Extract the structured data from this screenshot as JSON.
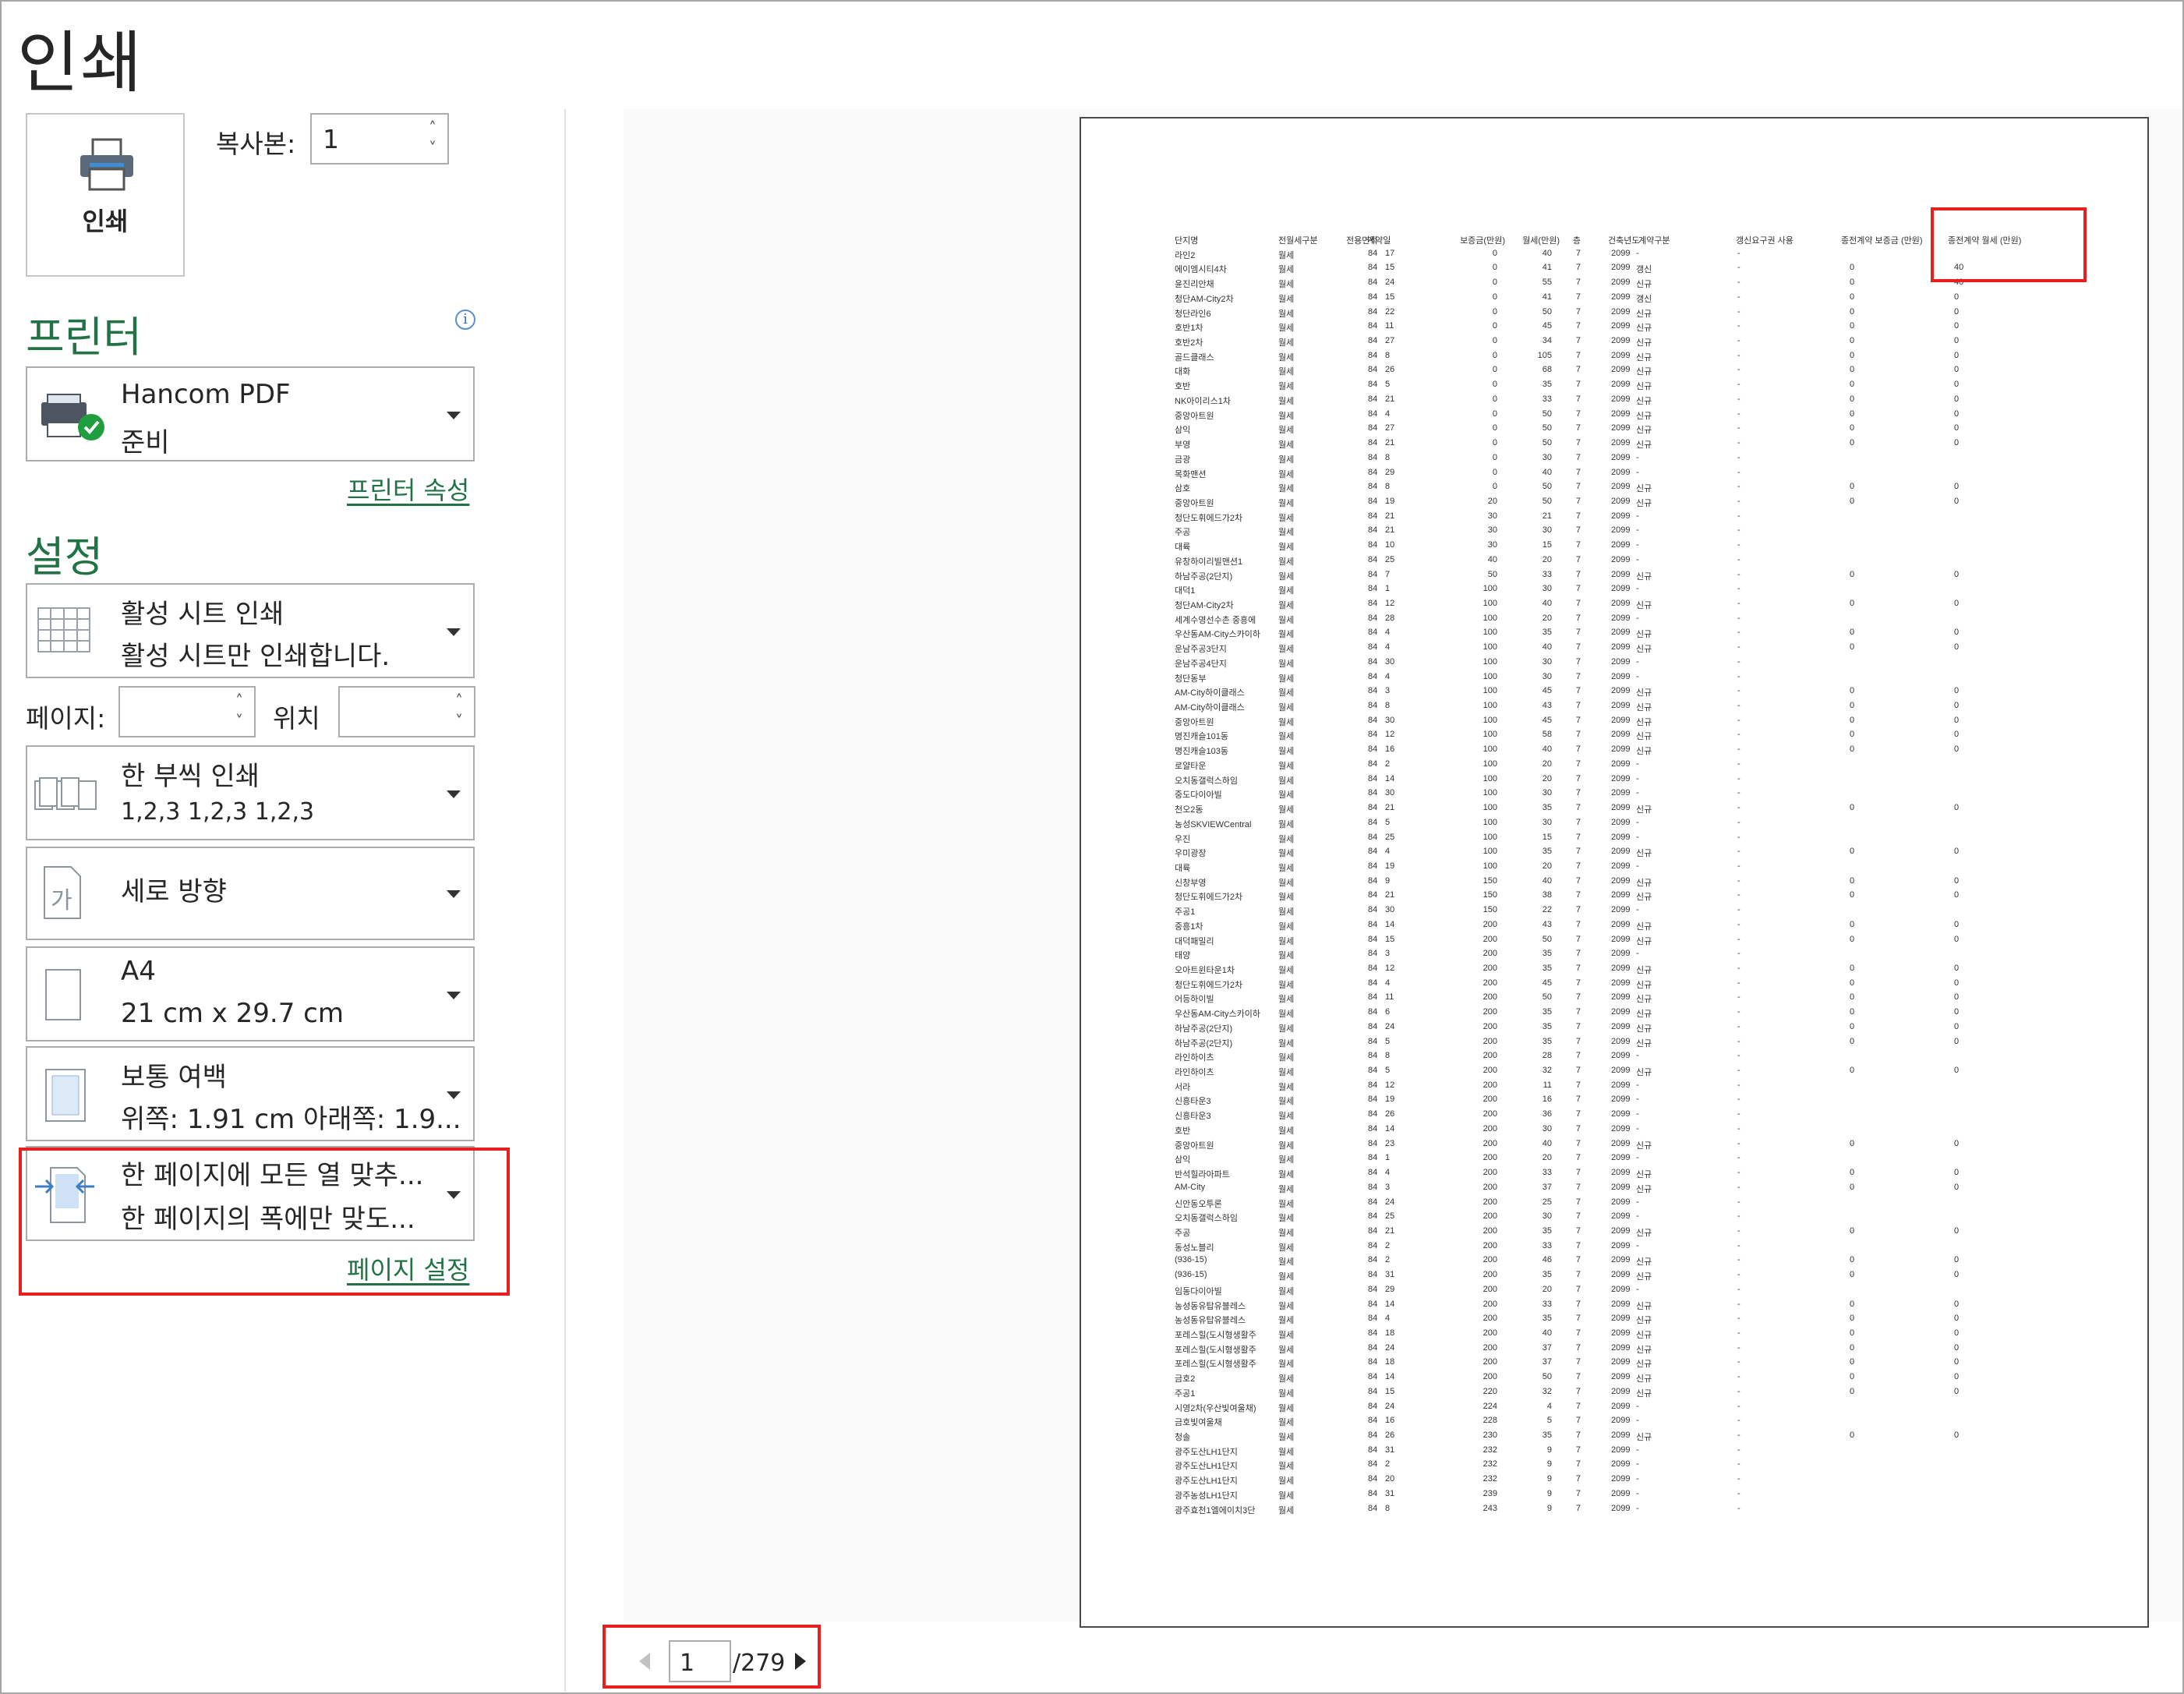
{
  "header": {
    "title": "인쇄"
  },
  "print_button": {
    "label": "인쇄"
  },
  "copies": {
    "label": "복사본:",
    "value": "1"
  },
  "printer_section": {
    "title": "프린터",
    "info": "i",
    "printer_name": "Hancom PDF",
    "printer_status": "준비",
    "properties_link": "프린터 속성"
  },
  "settings_section": {
    "title": "설정",
    "what": {
      "line1": "활성 시트 인쇄",
      "line2": "활성 시트만 인쇄합니다."
    },
    "pages_label": "페이지:",
    "to_label": "위치",
    "collate": {
      "line1": "한 부씩 인쇄",
      "line2": "1,2,3      1,2,3      1,2,3"
    },
    "orientation": {
      "line1": "세로 방향",
      "icon_text": "가"
    },
    "paper": {
      "line1": "A4",
      "line2": "21 cm x 29.7 cm"
    },
    "margins": {
      "line1": "보통 여백",
      "line2": "위쪽: 1.91 cm 아래쪽: 1.9..."
    },
    "scaling": {
      "line1": "한 페이지에 모든 열 맞추...",
      "line2": "한 페이지의 폭에만 맞도..."
    },
    "page_setup_link": "페이지 설정"
  },
  "pager": {
    "current": "1",
    "total": "/279"
  },
  "preview_table": {
    "headers": [
      "단지명",
      "전월세구분",
      "전용면적",
      "계약일",
      "보증금(만원)",
      "월세(만원)",
      "층",
      "건축년도",
      "계약구분",
      "갱신요구권 사용",
      "종전계약 보증금 (만원)",
      "종전계약 월세 (만원)"
    ],
    "rows": [
      [
        "라인2",
        "월세",
        "84",
        "17",
        "0",
        "40",
        "7",
        "2099",
        "-",
        "-",
        "",
        ""
      ],
      [
        "에이엠시티4차",
        "월세",
        "84",
        "15",
        "0",
        "41",
        "7",
        "2099",
        "갱신",
        "-",
        "0",
        "40"
      ],
      [
        "윤진리안채",
        "월세",
        "84",
        "24",
        "0",
        "55",
        "7",
        "2099",
        "신규",
        "-",
        "0",
        "40"
      ],
      [
        "청단AM-City2차",
        "월세",
        "84",
        "15",
        "0",
        "41",
        "7",
        "2099",
        "갱신",
        "-",
        "0",
        "0"
      ],
      [
        "청단라인6",
        "월세",
        "84",
        "22",
        "0",
        "50",
        "7",
        "2099",
        "신규",
        "-",
        "0",
        "0"
      ],
      [
        "호반1차",
        "월세",
        "84",
        "11",
        "0",
        "45",
        "7",
        "2099",
        "신규",
        "-",
        "0",
        "0"
      ],
      [
        "호반2차",
        "월세",
        "84",
        "27",
        "0",
        "34",
        "7",
        "2099",
        "신규",
        "-",
        "0",
        "0"
      ],
      [
        "골드클래스",
        "월세",
        "84",
        "8",
        "0",
        "105",
        "7",
        "2099",
        "신규",
        "-",
        "0",
        "0"
      ],
      [
        "대화",
        "월세",
        "84",
        "26",
        "0",
        "68",
        "7",
        "2099",
        "신규",
        "-",
        "0",
        "0"
      ],
      [
        "호반",
        "월세",
        "84",
        "5",
        "0",
        "35",
        "7",
        "2099",
        "신규",
        "-",
        "0",
        "0"
      ],
      [
        "NK아이리스1차",
        "월세",
        "84",
        "21",
        "0",
        "33",
        "7",
        "2099",
        "신규",
        "-",
        "0",
        "0"
      ],
      [
        "중앙아트원",
        "월세",
        "84",
        "4",
        "0",
        "50",
        "7",
        "2099",
        "신규",
        "-",
        "0",
        "0"
      ],
      [
        "삼익",
        "월세",
        "84",
        "27",
        "0",
        "50",
        "7",
        "2099",
        "신규",
        "-",
        "0",
        "0"
      ],
      [
        "부영",
        "월세",
        "84",
        "21",
        "0",
        "50",
        "7",
        "2099",
        "신규",
        "-",
        "0",
        "0"
      ],
      [
        "금광",
        "월세",
        "84",
        "8",
        "0",
        "30",
        "7",
        "2099",
        "-",
        "-",
        "",
        ""
      ],
      [
        "목화맨션",
        "월세",
        "84",
        "29",
        "0",
        "40",
        "7",
        "2099",
        "-",
        "-",
        "",
        ""
      ],
      [
        "삼호",
        "월세",
        "84",
        "8",
        "0",
        "50",
        "7",
        "2099",
        "신규",
        "-",
        "0",
        "0"
      ],
      [
        "중앙아트원",
        "월세",
        "84",
        "19",
        "20",
        "50",
        "7",
        "2099",
        "신규",
        "-",
        "0",
        "0"
      ],
      [
        "청단도휘에드가2차",
        "월세",
        "84",
        "21",
        "30",
        "21",
        "7",
        "2099",
        "-",
        "-",
        "",
        ""
      ],
      [
        "주공",
        "월세",
        "84",
        "21",
        "30",
        "30",
        "7",
        "2099",
        "-",
        "-",
        "",
        ""
      ],
      [
        "대륙",
        "월세",
        "84",
        "10",
        "30",
        "15",
        "7",
        "2099",
        "-",
        "-",
        "",
        ""
      ],
      [
        "유창하이리빌맨션1",
        "월세",
        "84",
        "25",
        "40",
        "20",
        "7",
        "2099",
        "-",
        "-",
        "",
        ""
      ],
      [
        "하남주공(2단지)",
        "월세",
        "84",
        "7",
        "50",
        "33",
        "7",
        "2099",
        "신규",
        "-",
        "0",
        "0"
      ],
      [
        "대덕1",
        "월세",
        "84",
        "1",
        "100",
        "30",
        "7",
        "2099",
        "-",
        "-",
        "",
        ""
      ],
      [
        "청단AM-City2차",
        "월세",
        "84",
        "12",
        "100",
        "40",
        "7",
        "2099",
        "신규",
        "-",
        "0",
        "0"
      ],
      [
        "세계수영선수촌 중흥에",
        "월세",
        "84",
        "28",
        "100",
        "20",
        "7",
        "2099",
        "-",
        "-",
        "",
        ""
      ],
      [
        "우산동AM-City스카이하",
        "월세",
        "84",
        "4",
        "100",
        "35",
        "7",
        "2099",
        "신규",
        "-",
        "0",
        "0"
      ],
      [
        "운남주공3단지",
        "월세",
        "84",
        "4",
        "100",
        "40",
        "7",
        "2099",
        "신규",
        "-",
        "0",
        "0"
      ],
      [
        "운남주공4단지",
        "월세",
        "84",
        "30",
        "100",
        "30",
        "7",
        "2099",
        "-",
        "-",
        "",
        ""
      ],
      [
        "청단동부",
        "월세",
        "84",
        "4",
        "100",
        "30",
        "7",
        "2099",
        "-",
        "-",
        "",
        ""
      ],
      [
        "AM-City하이클래스",
        "월세",
        "84",
        "3",
        "100",
        "45",
        "7",
        "2099",
        "신규",
        "-",
        "0",
        "0"
      ],
      [
        "AM-City하이클래스",
        "월세",
        "84",
        "8",
        "100",
        "43",
        "7",
        "2099",
        "신규",
        "-",
        "0",
        "0"
      ],
      [
        "중앙아트원",
        "월세",
        "84",
        "30",
        "100",
        "45",
        "7",
        "2099",
        "신규",
        "-",
        "0",
        "0"
      ],
      [
        "명진캐슬101동",
        "월세",
        "84",
        "12",
        "100",
        "58",
        "7",
        "2099",
        "신규",
        "-",
        "0",
        "0"
      ],
      [
        "명진캐슬103동",
        "월세",
        "84",
        "16",
        "100",
        "40",
        "7",
        "2099",
        "신규",
        "-",
        "0",
        "0"
      ],
      [
        "로얄타운",
        "월세",
        "84",
        "2",
        "100",
        "20",
        "7",
        "2099",
        "-",
        "-",
        "",
        ""
      ],
      [
        "오치동갤럭스하임",
        "월세",
        "84",
        "14",
        "100",
        "20",
        "7",
        "2099",
        "-",
        "-",
        "",
        ""
      ],
      [
        "중도다이아빌",
        "월세",
        "84",
        "30",
        "100",
        "30",
        "7",
        "2099",
        "-",
        "-",
        "",
        ""
      ],
      [
        "천오2동",
        "월세",
        "84",
        "21",
        "100",
        "35",
        "7",
        "2099",
        "신규",
        "-",
        "0",
        "0"
      ],
      [
        "농성SKVIEWCentral",
        "월세",
        "84",
        "5",
        "100",
        "30",
        "7",
        "2099",
        "-",
        "-",
        "",
        ""
      ],
      [
        "우진",
        "월세",
        "84",
        "25",
        "100",
        "15",
        "7",
        "2099",
        "-",
        "-",
        "",
        ""
      ],
      [
        "우미광장",
        "월세",
        "84",
        "4",
        "100",
        "35",
        "7",
        "2099",
        "신규",
        "-",
        "0",
        "0"
      ],
      [
        "대륙",
        "월세",
        "84",
        "19",
        "100",
        "20",
        "7",
        "2099",
        "-",
        "-",
        "",
        ""
      ],
      [
        "신창부영",
        "월세",
        "84",
        "9",
        "150",
        "40",
        "7",
        "2099",
        "신규",
        "-",
        "0",
        "0"
      ],
      [
        "청단도휘에드가2차",
        "월세",
        "84",
        "21",
        "150",
        "38",
        "7",
        "2099",
        "신규",
        "-",
        "0",
        "0"
      ],
      [
        "주공1",
        "월세",
        "84",
        "30",
        "150",
        "22",
        "7",
        "2099",
        "-",
        "-",
        "",
        ""
      ],
      [
        "중흥1차",
        "월세",
        "84",
        "14",
        "200",
        "43",
        "7",
        "2099",
        "신규",
        "-",
        "0",
        "0"
      ],
      [
        "대덕패밀리",
        "월세",
        "84",
        "15",
        "200",
        "50",
        "7",
        "2099",
        "신규",
        "-",
        "0",
        "0"
      ],
      [
        "태양",
        "월세",
        "84",
        "3",
        "200",
        "35",
        "7",
        "2099",
        "-",
        "-",
        "",
        ""
      ],
      [
        "오아트윈타운1차",
        "월세",
        "84",
        "12",
        "200",
        "35",
        "7",
        "2099",
        "신규",
        "-",
        "0",
        "0"
      ],
      [
        "청단도휘에드가2차",
        "월세",
        "84",
        "4",
        "200",
        "45",
        "7",
        "2099",
        "신규",
        "-",
        "0",
        "0"
      ],
      [
        "어등하이빌",
        "월세",
        "84",
        "11",
        "200",
        "50",
        "7",
        "2099",
        "신규",
        "-",
        "0",
        "0"
      ],
      [
        "우산동AM-City스카이하",
        "월세",
        "84",
        "6",
        "200",
        "35",
        "7",
        "2099",
        "신규",
        "-",
        "0",
        "0"
      ],
      [
        "하남주공(2단지)",
        "월세",
        "84",
        "24",
        "200",
        "35",
        "7",
        "2099",
        "신규",
        "-",
        "0",
        "0"
      ],
      [
        "하남주공(2단지)",
        "월세",
        "84",
        "5",
        "200",
        "35",
        "7",
        "2099",
        "신규",
        "-",
        "0",
        "0"
      ],
      [
        "라인하이츠",
        "월세",
        "84",
        "8",
        "200",
        "28",
        "7",
        "2099",
        "-",
        "-",
        "",
        ""
      ],
      [
        "라인하이츠",
        "월세",
        "84",
        "5",
        "200",
        "32",
        "7",
        "2099",
        "신규",
        "-",
        "0",
        "0"
      ],
      [
        "서라",
        "월세",
        "84",
        "12",
        "200",
        "11",
        "7",
        "2099",
        "-",
        "-",
        "",
        ""
      ],
      [
        "신흥타운3",
        "월세",
        "84",
        "19",
        "200",
        "16",
        "7",
        "2099",
        "-",
        "-",
        "",
        ""
      ],
      [
        "신흥타운3",
        "월세",
        "84",
        "26",
        "200",
        "36",
        "7",
        "2099",
        "-",
        "-",
        "",
        ""
      ],
      [
        "호반",
        "월세",
        "84",
        "14",
        "200",
        "30",
        "7",
        "2099",
        "-",
        "-",
        "",
        ""
      ],
      [
        "중앙아트원",
        "월세",
        "84",
        "23",
        "200",
        "40",
        "7",
        "2099",
        "신규",
        "-",
        "0",
        "0"
      ],
      [
        "삼익",
        "월세",
        "84",
        "1",
        "200",
        "20",
        "7",
        "2099",
        "-",
        "-",
        "",
        ""
      ],
      [
        "반석힐라아파트",
        "월세",
        "84",
        "4",
        "200",
        "33",
        "7",
        "2099",
        "신규",
        "-",
        "0",
        "0"
      ],
      [
        "AM-City",
        "월세",
        "84",
        "3",
        "200",
        "37",
        "7",
        "2099",
        "신규",
        "-",
        "0",
        "0"
      ],
      [
        "신안동오투론",
        "월세",
        "84",
        "24",
        "200",
        "25",
        "7",
        "2099",
        "-",
        "-",
        "",
        ""
      ],
      [
        "오치동갤럭스하임",
        "월세",
        "84",
        "25",
        "200",
        "30",
        "7",
        "2099",
        "-",
        "-",
        "",
        ""
      ],
      [
        "주공",
        "월세",
        "84",
        "21",
        "200",
        "35",
        "7",
        "2099",
        "신규",
        "-",
        "0",
        "0"
      ],
      [
        "동성노블리",
        "월세",
        "84",
        "2",
        "200",
        "33",
        "7",
        "2099",
        "-",
        "-",
        "",
        ""
      ],
      [
        "(936-15)",
        "월세",
        "84",
        "2",
        "200",
        "46",
        "7",
        "2099",
        "신규",
        "-",
        "0",
        "0"
      ],
      [
        "(936-15)",
        "월세",
        "84",
        "31",
        "200",
        "35",
        "7",
        "2099",
        "신규",
        "-",
        "0",
        "0"
      ],
      [
        "임동다이아빌",
        "월세",
        "84",
        "29",
        "200",
        "20",
        "7",
        "2099",
        "-",
        "-",
        "",
        ""
      ],
      [
        "농성동유탑유블레스",
        "월세",
        "84",
        "14",
        "200",
        "33",
        "7",
        "2099",
        "신규",
        "-",
        "0",
        "0"
      ],
      [
        "농성동유탑유블레스",
        "월세",
        "84",
        "4",
        "200",
        "35",
        "7",
        "2099",
        "신규",
        "-",
        "0",
        "0"
      ],
      [
        "포레스힐(도시형생활주",
        "월세",
        "84",
        "18",
        "200",
        "40",
        "7",
        "2099",
        "신규",
        "-",
        "0",
        "0"
      ],
      [
        "포레스힐(도시형생활주",
        "월세",
        "84",
        "24",
        "200",
        "37",
        "7",
        "2099",
        "신규",
        "-",
        "0",
        "0"
      ],
      [
        "포레스힐(도시형생활주",
        "월세",
        "84",
        "18",
        "200",
        "37",
        "7",
        "2099",
        "신규",
        "-",
        "0",
        "0"
      ],
      [
        "금호2",
        "월세",
        "84",
        "14",
        "200",
        "50",
        "7",
        "2099",
        "신규",
        "-",
        "0",
        "0"
      ],
      [
        "주공1",
        "월세",
        "84",
        "15",
        "220",
        "32",
        "7",
        "2099",
        "신규",
        "-",
        "0",
        "0"
      ],
      [
        "시영2차(우산빛여울채)",
        "월세",
        "84",
        "24",
        "224",
        "4",
        "7",
        "2099",
        "-",
        "-",
        "",
        ""
      ],
      [
        "금호빛여울채",
        "월세",
        "84",
        "16",
        "228",
        "5",
        "7",
        "2099",
        "-",
        "-",
        "",
        ""
      ],
      [
        "청솔",
        "월세",
        "84",
        "26",
        "230",
        "35",
        "7",
        "2099",
        "신규",
        "-",
        "0",
        "0"
      ],
      [
        "광주도산LH1단지",
        "월세",
        "84",
        "31",
        "232",
        "9",
        "7",
        "2099",
        "-",
        "-",
        "",
        ""
      ],
      [
        "광주도산LH1단지",
        "월세",
        "84",
        "2",
        "232",
        "9",
        "7",
        "2099",
        "-",
        "-",
        "",
        ""
      ],
      [
        "광주도산LH1단지",
        "월세",
        "84",
        "20",
        "232",
        "9",
        "7",
        "2099",
        "-",
        "-",
        "",
        ""
      ],
      [
        "광주농성LH1단지",
        "월세",
        "84",
        "31",
        "239",
        "9",
        "7",
        "2099",
        "-",
        "-",
        "",
        ""
      ],
      [
        "광주효천1엘에이치3단",
        "월세",
        "84",
        "8",
        "243",
        "9",
        "7",
        "2099",
        "-",
        "-",
        "",
        ""
      ]
    ]
  }
}
